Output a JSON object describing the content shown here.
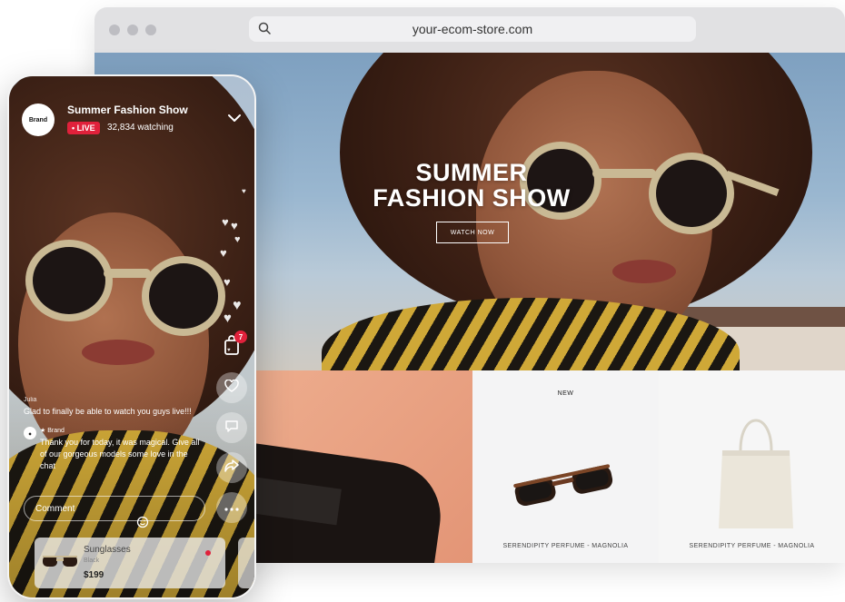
{
  "browser": {
    "url": "your-ecom-store.com"
  },
  "hero": {
    "title_line1": "SUMMER",
    "title_line2": "FASHION SHOW",
    "cta_label": "WATCH NOW"
  },
  "products": [
    {
      "badge": "NEW",
      "name": "SERENDIPITY PERFUME - MAGNOLIA"
    },
    {
      "badge": "",
      "name": "SERENDIPITY PERFUME - MAGNOLIA"
    }
  ],
  "phone": {
    "brand_avatar": "Brand",
    "show_title": "Summer Fashion Show",
    "live_label": "• LIVE",
    "watching": "32,834 watching",
    "cart_count": "7",
    "chat": {
      "message1_author": "Julia",
      "message1_text": "Glad to finally be able to watch you guys live!!!",
      "message2_author": "Brand",
      "message2_text": "Thank you for today, it was magical. Give all of our gorgeous models some love in the chat"
    },
    "comment_placeholder": "Comment",
    "product_card": {
      "name": "Sunglasses",
      "color": "Black",
      "price": "$199"
    }
  },
  "icons": {
    "search": "search-icon",
    "chevron": "chevron-down-icon",
    "bag": "shopping-bag-icon",
    "heart": "heart-icon",
    "chat": "chat-icon",
    "share": "share-icon",
    "more": "more-icon",
    "emoji": "emoji-icon"
  },
  "colors": {
    "live": "#e0213b",
    "accent_frame": "#c9b994"
  }
}
